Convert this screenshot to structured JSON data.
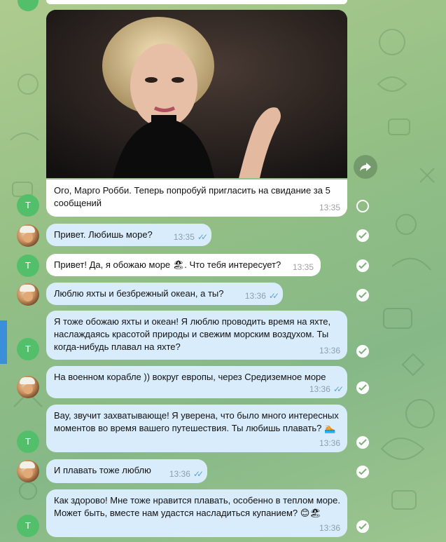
{
  "colors": {
    "accent": "#5ea3d6",
    "incoming": "#ffffff",
    "outgoing": "#d9ecfb",
    "avatar_t": "#53bf6b"
  },
  "icons": {
    "share": "share-arrow-icon",
    "read": "double-check-icon",
    "select_empty": "selection-circle-icon",
    "select_done": "selected-check-icon"
  },
  "messages": [
    {
      "text": "Ого, Марго Робби. Теперь попробуй пригласить на свидание за 5 сообщений",
      "time": "13:35",
      "avatar": "Т"
    },
    {
      "text": "Привет. Любишь море?",
      "time": "13:35"
    },
    {
      "text": "Привет! Да, я обожаю море 🏖. Что тебя интересует?",
      "time": "13:35",
      "avatar": "Т"
    },
    {
      "text": "Люблю яхты и безбрежный океан, а ты?",
      "time": "13:36"
    },
    {
      "text": "Я тоже обожаю яхты и океан! Я люблю проводить время на яхте, наслаждаясь красотой природы и свежим морским воздухом. Ты когда-нибудь плавал на яхте?",
      "time": "13:36",
      "avatar": "Т"
    },
    {
      "text": "На военном корабле )) вокруг европы, через Средиземное море",
      "time": "13:36"
    },
    {
      "text": "Вау, звучит захватывающе! Я уверена, что было много интересных моментов во время вашего путешествия. Ты любишь плавать? 🏊",
      "time": "13:36",
      "avatar": "Т"
    },
    {
      "text": "И плавать тоже люблю",
      "time": "13:36"
    },
    {
      "text": "Как здорово! Мне тоже нравится плавать, особенно в теплом море. Может быть, вместе нам удастся насладиться купанием? 😊🏖",
      "time": "13:36",
      "avatar": "Т"
    }
  ]
}
